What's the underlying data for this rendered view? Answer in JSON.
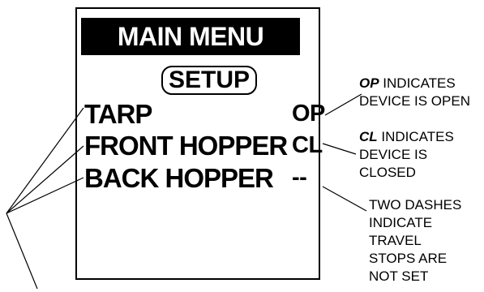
{
  "menu": {
    "title": "MAIN MENU",
    "selected_option": "SETUP",
    "items": [
      {
        "label": "TARP",
        "status": "OP"
      },
      {
        "label": "FRONT HOPPER",
        "status": "CL"
      },
      {
        "label": "BACK HOPPER",
        "status": "--"
      }
    ]
  },
  "notes": {
    "open": {
      "code": "OP",
      "text": " INDICATES\nDEVICE IS OPEN"
    },
    "closed": {
      "code": "CL",
      "text": " INDICATES\nDEVICE IS\nCLOSED"
    },
    "unset": {
      "text": "TWO DASHES\nINDICATE\nTRAVEL\nSTOPS ARE\nNOT SET"
    }
  }
}
